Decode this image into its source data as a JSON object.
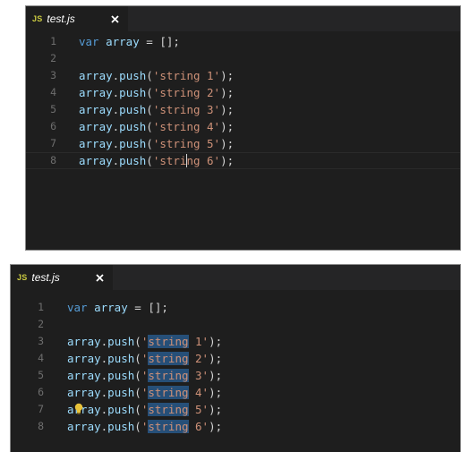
{
  "editors": [
    {
      "tab": {
        "icon_label": "JS",
        "filename": "test.js",
        "close_icon": "close-icon"
      },
      "cursor_line": 8,
      "lines": [
        {
          "num": "1",
          "parts": [
            [
              "kw",
              "var"
            ],
            [
              "plain",
              " "
            ],
            [
              "id",
              "array"
            ],
            [
              "plain",
              " = [];"
            ]
          ]
        },
        {
          "num": "2",
          "parts": []
        },
        {
          "num": "3",
          "parts": [
            [
              "id",
              "array"
            ],
            [
              "plain",
              "."
            ],
            [
              "id",
              "push"
            ],
            [
              "plain",
              "("
            ],
            [
              "str",
              "'string 1'"
            ],
            [
              "plain",
              ");"
            ]
          ]
        },
        {
          "num": "4",
          "parts": [
            [
              "id",
              "array"
            ],
            [
              "plain",
              "."
            ],
            [
              "id",
              "push"
            ],
            [
              "plain",
              "("
            ],
            [
              "str",
              "'string 2'"
            ],
            [
              "plain",
              ");"
            ]
          ]
        },
        {
          "num": "5",
          "parts": [
            [
              "id",
              "array"
            ],
            [
              "plain",
              "."
            ],
            [
              "id",
              "push"
            ],
            [
              "plain",
              "("
            ],
            [
              "str",
              "'string 3'"
            ],
            [
              "plain",
              ");"
            ]
          ]
        },
        {
          "num": "6",
          "parts": [
            [
              "id",
              "array"
            ],
            [
              "plain",
              "."
            ],
            [
              "id",
              "push"
            ],
            [
              "plain",
              "("
            ],
            [
              "str",
              "'string 4'"
            ],
            [
              "plain",
              ");"
            ]
          ]
        },
        {
          "num": "7",
          "parts": [
            [
              "id",
              "array"
            ],
            [
              "plain",
              "."
            ],
            [
              "id",
              "push"
            ],
            [
              "plain",
              "("
            ],
            [
              "str",
              "'string 5'"
            ],
            [
              "plain",
              ");"
            ]
          ]
        },
        {
          "num": "8",
          "parts": [
            [
              "id",
              "array"
            ],
            [
              "plain",
              "."
            ],
            [
              "id",
              "push"
            ],
            [
              "plain",
              "("
            ],
            [
              "str",
              "'stri"
            ],
            [
              "cursor",
              ""
            ],
            [
              "str",
              "ng 6'"
            ],
            [
              "plain",
              ");"
            ]
          ]
        }
      ]
    },
    {
      "tab": {
        "icon_label": "JS",
        "filename": "test.js",
        "close_icon": "close-icon"
      },
      "lightbulb_line": 7,
      "lines": [
        {
          "num": "1",
          "parts": [
            [
              "kw",
              "var"
            ],
            [
              "plain",
              " "
            ],
            [
              "id",
              "array"
            ],
            [
              "plain",
              " = [];"
            ]
          ]
        },
        {
          "num": "2",
          "parts": []
        },
        {
          "num": "3",
          "parts": [
            [
              "id",
              "array"
            ],
            [
              "plain",
              "."
            ],
            [
              "id",
              "push"
            ],
            [
              "plain",
              "("
            ],
            [
              "str",
              "'"
            ],
            [
              "hlstr",
              "string"
            ],
            [
              "str",
              " 1'"
            ],
            [
              "plain",
              ");"
            ]
          ]
        },
        {
          "num": "4",
          "parts": [
            [
              "id",
              "array"
            ],
            [
              "plain",
              "."
            ],
            [
              "id",
              "push"
            ],
            [
              "plain",
              "("
            ],
            [
              "str",
              "'"
            ],
            [
              "hlstr",
              "string"
            ],
            [
              "str",
              " 2'"
            ],
            [
              "plain",
              ");"
            ]
          ]
        },
        {
          "num": "5",
          "parts": [
            [
              "id",
              "array"
            ],
            [
              "plain",
              "."
            ],
            [
              "id",
              "push"
            ],
            [
              "plain",
              "("
            ],
            [
              "str",
              "'"
            ],
            [
              "hlstr",
              "string"
            ],
            [
              "str",
              " 3'"
            ],
            [
              "plain",
              ");"
            ]
          ]
        },
        {
          "num": "6",
          "parts": [
            [
              "id",
              "array"
            ],
            [
              "plain",
              "."
            ],
            [
              "id",
              "push"
            ],
            [
              "plain",
              "("
            ],
            [
              "str",
              "'"
            ],
            [
              "hlstr",
              "string"
            ],
            [
              "str",
              " 4'"
            ],
            [
              "plain",
              ");"
            ]
          ]
        },
        {
          "num": "7",
          "parts": [
            [
              "id",
              "array"
            ],
            [
              "plain",
              "."
            ],
            [
              "id",
              "push"
            ],
            [
              "plain",
              "("
            ],
            [
              "str",
              "'"
            ],
            [
              "hlstr",
              "string"
            ],
            [
              "str",
              " 5'"
            ],
            [
              "plain",
              ");"
            ]
          ]
        },
        {
          "num": "8",
          "parts": [
            [
              "id",
              "array"
            ],
            [
              "plain",
              "."
            ],
            [
              "id",
              "push"
            ],
            [
              "plain",
              "("
            ],
            [
              "str",
              "'"
            ],
            [
              "hlstr",
              "string"
            ],
            [
              "str",
              " 6'"
            ],
            [
              "plain",
              ");"
            ]
          ]
        }
      ]
    }
  ],
  "colors": {
    "keyword": "#569cd6",
    "identifier": "#9cdcfe",
    "string": "#ce9178",
    "selection_highlight": "#264f78",
    "js_icon": "#cbcb41",
    "lightbulb": "#e8c33a"
  }
}
